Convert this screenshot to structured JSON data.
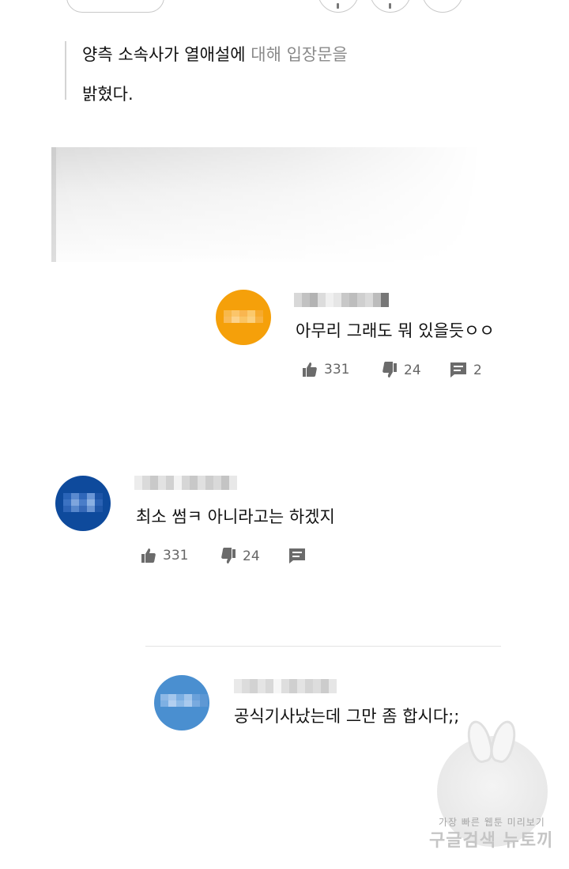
{
  "article": {
    "quote_part1": "양측 소속사가 열애설에",
    "quote_part2": "대해 입장문을",
    "quote_line2": "밝혔다."
  },
  "comments": [
    {
      "text": "아무리 그래도 뭐 있을듯ㅇㅇ",
      "likes": "331",
      "dislikes": "24",
      "replies": "2",
      "avatar_color": "#f5a00a"
    },
    {
      "text": "최소 썸ㅋ 아니라고는 하겠지",
      "likes": "331",
      "dislikes": "24",
      "replies": "",
      "avatar_color": "#0e4a9c"
    },
    {
      "text": "공식기사났는데 그만 좀 합시다;;",
      "avatar_color": "#4a8fd0"
    }
  ],
  "icons": {
    "like": "thumbs-up-icon",
    "dislike": "thumbs-down-icon",
    "reply": "comment-icon"
  },
  "watermark": {
    "top": "가장 빠른 웹툰 미리보기",
    "bottom": "구글검색 뉴토끼"
  }
}
